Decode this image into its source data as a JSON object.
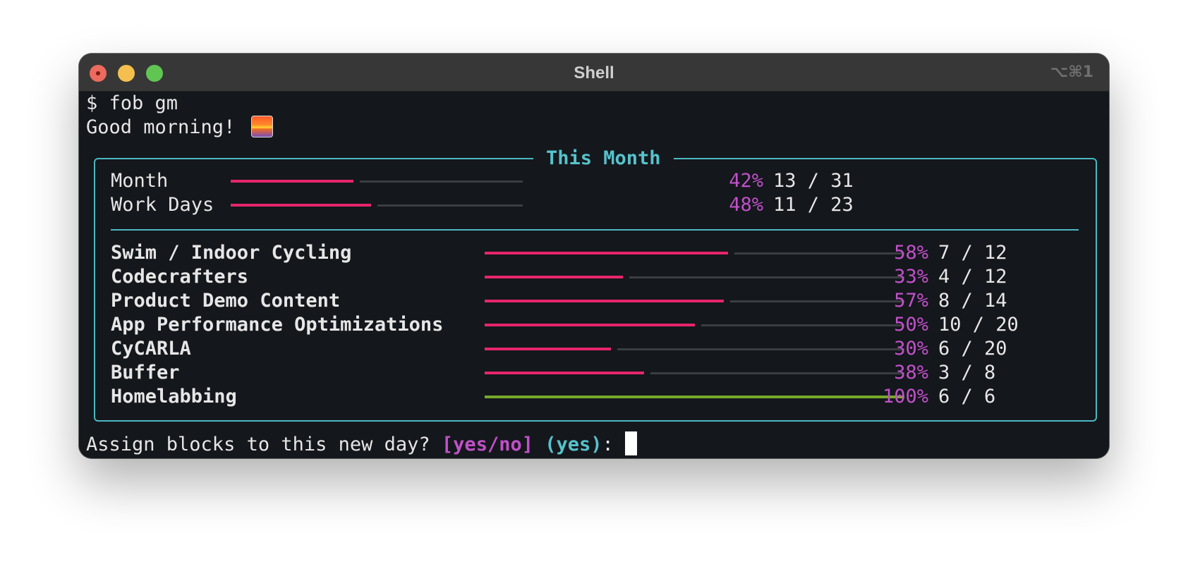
{
  "window": {
    "title": "Shell",
    "shortcut": "⌥⌘1",
    "colors": {
      "close": "#ed6a5e",
      "minimize": "#f4bf4f",
      "zoom": "#61c554",
      "background": "#14171c"
    }
  },
  "terminal": {
    "command": "$ fob gm",
    "greeting": "Good morning!",
    "greeting_icon": "sunrise-emoji",
    "panel": {
      "title": "This Month",
      "summary": [
        {
          "label": "Month",
          "percent_text": "42%",
          "count_text": "13 / 31",
          "progress": 0.42
        },
        {
          "label": "Work Days",
          "percent_text": "48%",
          "count_text": "11 / 23",
          "progress": 0.48
        }
      ],
      "goals": [
        {
          "label": "Swim / Indoor Cycling",
          "percent_text": "58%",
          "count_text": "7 / 12",
          "progress": 0.58
        },
        {
          "label": "Codecrafters",
          "percent_text": "33%",
          "count_text": "4 / 12",
          "progress": 0.33
        },
        {
          "label": "Product Demo Content",
          "percent_text": "57%",
          "count_text": "8 / 14",
          "progress": 0.57
        },
        {
          "label": "App Performance Optimizations",
          "percent_text": "50%",
          "count_text": "10 / 20",
          "progress": 0.5
        },
        {
          "label": "CyCARLA",
          "percent_text": "30%",
          "count_text": "6 / 20",
          "progress": 0.3
        },
        {
          "label": "Buffer",
          "percent_text": "38%",
          "count_text": "3 / 8",
          "progress": 0.38
        },
        {
          "label": "Homelabbing",
          "percent_text": "100%",
          "count_text": "6 / 6",
          "progress": 1.0
        }
      ],
      "colors": {
        "border": "#4bb8c2",
        "bar_fill": "#e6256b",
        "bar_complete": "#76a82a",
        "bar_track": "#3a3d42",
        "percent": "#c150c9"
      }
    },
    "prompt": {
      "question": "Assign blocks to this new day? ",
      "options": "[yes/no]",
      "default": "(yes)",
      "suffix": ": "
    }
  }
}
